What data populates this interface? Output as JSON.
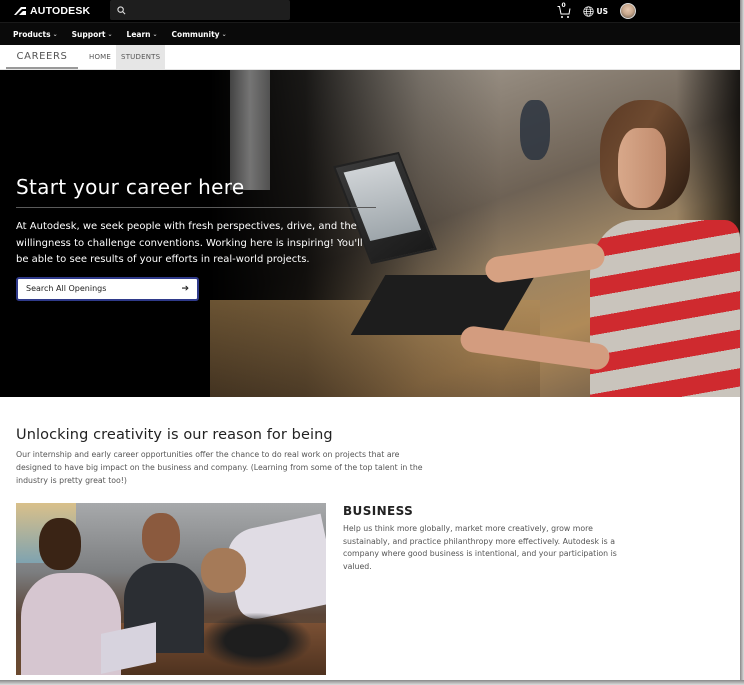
{
  "topbar": {
    "brand": "AUTODESK",
    "search_placeholder": "",
    "cart_count": "0",
    "region": "US"
  },
  "nav": {
    "items": [
      {
        "label": "Products"
      },
      {
        "label": "Support"
      },
      {
        "label": "Learn"
      },
      {
        "label": "Community"
      }
    ]
  },
  "subnav": {
    "section": "CAREERS",
    "tabs": [
      {
        "label": "HOME",
        "active": false
      },
      {
        "label": "STUDENTS",
        "active": true
      }
    ]
  },
  "hero": {
    "title": "Start your career here",
    "text": "At Autodesk, we seek people with fresh perspectives, drive, and the willingness to challenge conventions. Working here is inspiring! You'll be able to see results of your efforts in real-world projects.",
    "button_label": "Search All Openings",
    "accent_color": "#2f3a8a"
  },
  "section": {
    "title": "Unlocking creativity is our reason for being",
    "text": "Our internship and early career opportunities offer the chance to do real work on projects that are designed to have big impact on the business and company. (Learning from some of the top talent in the industry is pretty great too!)"
  },
  "cards": [
    {
      "title": "BUSINESS",
      "text": "Help us think more globally, market more creatively, grow more sustainably, and practice philanthropy more effectively. Autodesk is a company where good business is intentional, and your participation is valued."
    }
  ]
}
